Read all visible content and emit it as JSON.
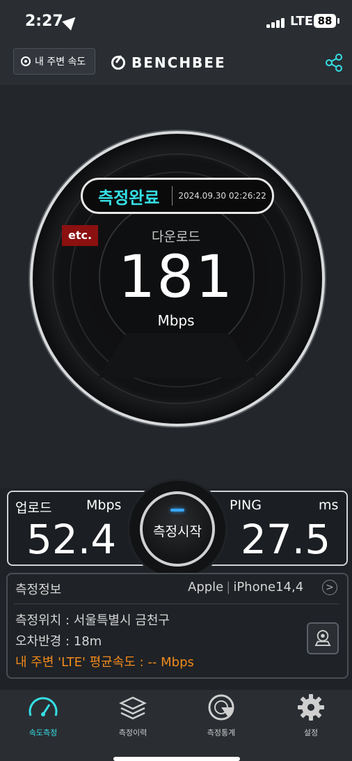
{
  "status": {
    "time": "2:27",
    "network": "LTE",
    "battery": "88"
  },
  "topbar": {
    "nearby_label": "내 주변 속도",
    "brand": "BENCHBEE"
  },
  "result": {
    "status": "측정완료",
    "timestamp": "2024.09.30 02:26:22",
    "badge": "etc.",
    "download_label": "다운로드",
    "download_value": "181",
    "download_unit": "Mbps"
  },
  "upload": {
    "label": "업로드",
    "unit": "Mbps",
    "value": "52.4"
  },
  "ping": {
    "label": "PING",
    "unit": "ms",
    "value": "27.5"
  },
  "start_button": "측정시작",
  "info": {
    "title": "측정정보",
    "vendor": "Apple",
    "model": "iPhone14,4",
    "location": "측정위치 : 서울특별시 금천구",
    "radius": "오차반경 : 18m",
    "average": "내 주변 'LTE' 평균속도 : -- Mbps"
  },
  "tabs": [
    {
      "label": "속도측정",
      "icon": "speedometer-icon"
    },
    {
      "label": "측정이력",
      "icon": "layers-icon"
    },
    {
      "label": "측정통계",
      "icon": "stats-disc-icon"
    },
    {
      "label": "설정",
      "icon": "gear-icon"
    }
  ],
  "colors": {
    "accent": "#35e0e6",
    "warning": "#f08a1c",
    "badge": "#8b1010"
  }
}
